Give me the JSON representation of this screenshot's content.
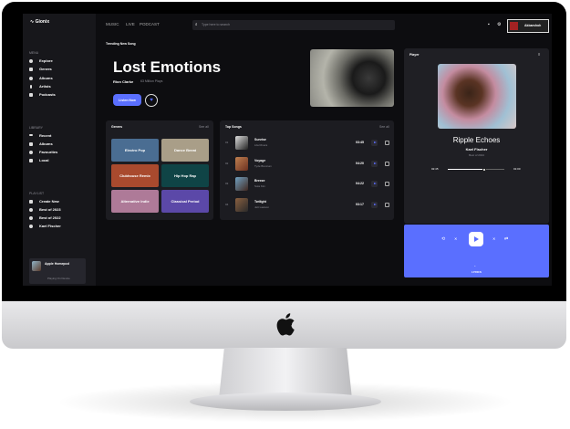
{
  "app": {
    "name": "Gionix"
  },
  "nav": [
    "MUSIC",
    "LIVE",
    "PODCAST"
  ],
  "search": {
    "placeholder": "Type here to search"
  },
  "user": {
    "name": "Akbarshoh"
  },
  "sidebar": {
    "menu_title": "MENU",
    "menu": [
      "Explore",
      "Genres",
      "Albums",
      "Artists",
      "Podcasts"
    ],
    "library_title": "LIBRARY",
    "library": [
      "Recent",
      "Albums",
      "Favourites",
      "Local"
    ],
    "playlist_title": "PLAYLIST",
    "playlist": [
      "Create New",
      "Best of 2023",
      "Best of 2022",
      "Kael Fischer"
    ],
    "device": {
      "name": "Apple Homepod",
      "status": "Playing On Device"
    }
  },
  "hero": {
    "label": "Trending New Song",
    "title": "Lost Emotions",
    "artist": "Rion Clarke",
    "plays": "63 Million Plays",
    "listen": "Listen Now"
  },
  "genres": {
    "title": "Genres",
    "see_all": "See all",
    "items": [
      {
        "name": "Electro Pop",
        "color": "#4a6d92"
      },
      {
        "name": "Dance Beeat",
        "color": "#a99e88"
      },
      {
        "name": "Clubhouse Remix",
        "color": "#a94a2e"
      },
      {
        "name": "Hip Hop Rap",
        "color": "#0f4446"
      },
      {
        "name": "Alternative Indie",
        "color": "#ae7a98"
      },
      {
        "name": "Classical Period",
        "color": "#5b48a8"
      }
    ]
  },
  "top_songs": {
    "title": "Top Songs",
    "see_all": "See all",
    "items": [
      {
        "num": "01",
        "title": "Sunrise",
        "artist": "Lila Rivera",
        "time": "03:45"
      },
      {
        "num": "02",
        "title": "Voyage",
        "artist": "Tyde Brennan",
        "time": "04:20"
      },
      {
        "num": "03",
        "title": "Breeze",
        "artist": "Sola Kim",
        "time": "04:22"
      },
      {
        "num": "04",
        "title": "Twilight",
        "artist": "Jett Lawson",
        "time": "03:17"
      }
    ]
  },
  "player": {
    "title": "Player",
    "song": "Ripple Echoes",
    "artist": "Kael Fischer",
    "album": "Best of 2024",
    "elapsed": "02:45",
    "total": "01:00",
    "progress": 0.65,
    "lyrics": "LYRICS"
  },
  "colors": {
    "accent": "#5a6fff"
  }
}
